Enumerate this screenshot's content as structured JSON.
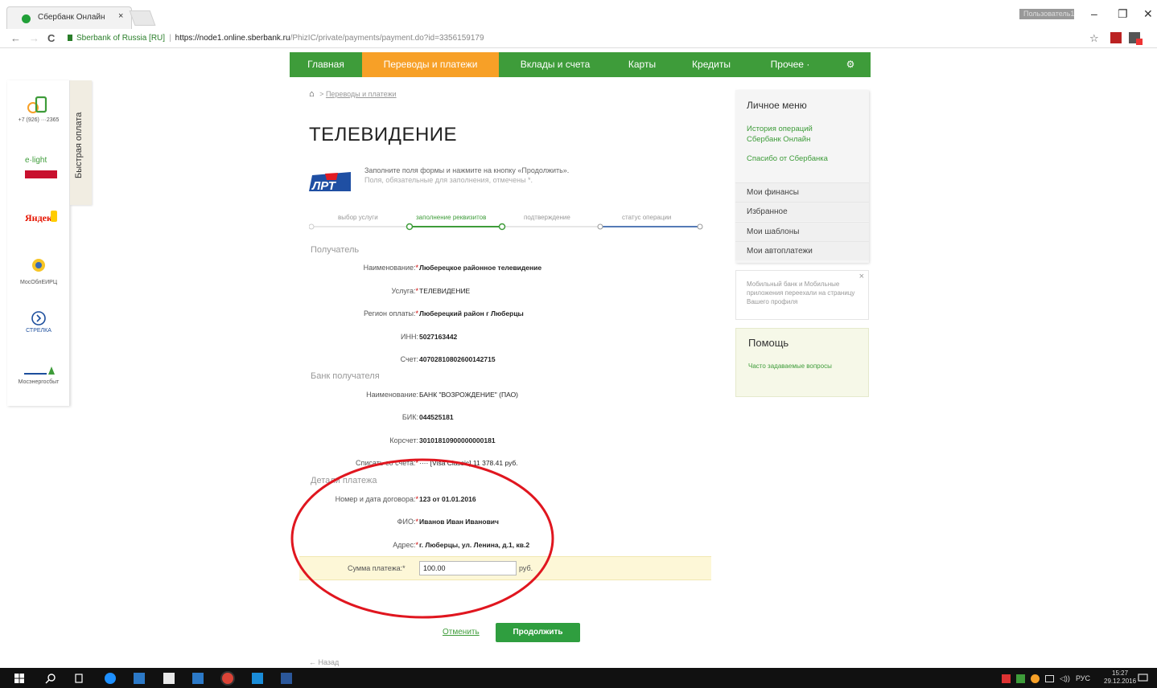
{
  "browser": {
    "tab_title": "Сбербанк Онлайн",
    "tab_close": "×",
    "user_chip": "Пользователь1",
    "url_site": "Sberbank of Russia [RU]",
    "url_sep": "|",
    "url_host": "https://node1.online.sberbank.ru",
    "url_path": "/PhizIC/private/payments/payment.do?id=3356159179",
    "btn_back": "←",
    "btn_forward": "→",
    "btn_reload": "C",
    "win_minimize": "–",
    "win_maximize": "❐",
    "win_close": "✕",
    "star": "☆"
  },
  "nav": {
    "items": [
      {
        "label": "Главная"
      },
      {
        "label": "Переводы и платежи"
      },
      {
        "label": "Вклады и счета"
      },
      {
        "label": "Карты"
      },
      {
        "label": "Кредиты"
      },
      {
        "label": "Прочее ·"
      }
    ],
    "settings_icon": "⚙"
  },
  "quickpay": {
    "tab_label": "Быстрая оплата",
    "items": [
      {
        "label": "+7 (926) ···2365",
        "icon": "phone-icon"
      },
      {
        "label": "",
        "icon": "enlight-logo"
      },
      {
        "label": "Яндекс",
        "icon": "yandex-logo"
      },
      {
        "label": "МосОблЕИРЦ",
        "icon": "mosobleirc-logo"
      },
      {
        "label": "СТРЕЛКА",
        "icon": "strelka-logo"
      },
      {
        "label": "Мосэнергосбыт",
        "icon": "mosenergo-logo"
      }
    ]
  },
  "breadcrumb": {
    "home_icon": "home-icon",
    "home_glyph": "⌂",
    "sep": ">",
    "crumb": "Переводы и платежи"
  },
  "page": {
    "title": "ТЕЛЕВИДЕНИЕ",
    "instruction": "Заполните поля формы и нажмите на кнопку «Продолжить».",
    "instruction_small": "Поля, обязательные для заполнения, отмечены *."
  },
  "steps": [
    {
      "label": "выбор услуги",
      "active": false
    },
    {
      "label": "заполнение реквизитов",
      "active": true
    },
    {
      "label": "подтверждение",
      "active": false
    },
    {
      "label": "статус операции",
      "active": false
    }
  ],
  "sections": {
    "recipient": "Получатель",
    "bank": "Банк получателя",
    "payment": "Детали платежа"
  },
  "recipient_fields": [
    {
      "label": "Наименование:",
      "required": true,
      "value": "Люберецкое районное телевидение"
    },
    {
      "label": "Услуга:",
      "required": true,
      "value": "ТЕЛЕВИДЕНИЕ"
    },
    {
      "label": "Регион оплаты:",
      "required": true,
      "value": "Люберецкий район г Люберцы"
    },
    {
      "label": "ИНН:",
      "required": false,
      "value": "5027163442"
    },
    {
      "label": "Счет:",
      "required": false,
      "value": "40702810802600142715"
    }
  ],
  "bank_fields": [
    {
      "label": "Наименование:",
      "required": false,
      "value": "БАНК \"ВОЗРОЖДЕНИЕ\" (ПАО)"
    },
    {
      "label": "БИК:",
      "required": false,
      "value": "044525181"
    },
    {
      "label": "Корсчет:",
      "required": false,
      "value": "30101810900000000181"
    }
  ],
  "debit": {
    "label": "Списать со счета:",
    "required": true,
    "value": "····   [Visa Classic] 11 378.41   руб."
  },
  "payment_fields": [
    {
      "label": "Номер и дата договора:",
      "required": true,
      "value": "123 от 01.01.2016"
    },
    {
      "label": "ФИО:",
      "required": true,
      "value": "Иванов Иван Иванович"
    },
    {
      "label": "Адрес:",
      "required": true,
      "value": "г. Люберцы, ул. Ленина, д.1, кв.2"
    }
  ],
  "amount": {
    "label": "Сумма платежа:",
    "value": "100.00",
    "currency": "руб."
  },
  "req_mark": "*",
  "actions": {
    "cancel": "Отменить",
    "continue": "Продолжить",
    "back": "← Назад"
  },
  "personal_menu": {
    "title": "Личное меню",
    "links": [
      "История операций Сбербанк Онлайн",
      "Спасибо от Сбербанка"
    ],
    "items": [
      "Мои финансы",
      "Избранное",
      "Мои шаблоны",
      "Мои автоплатежи"
    ]
  },
  "notice": {
    "text": "Мобильный банк и Мобильные приложения переехали на страницу Вашего профиля",
    "close": "×"
  },
  "help": {
    "title": "Помощь",
    "link": "Часто задаваемые вопросы"
  },
  "taskbar": {
    "lang": "РУС",
    "time": "15:27",
    "date": "29.12.2016"
  },
  "colors": {
    "nav_green": "#3e9c3a",
    "nav_active": "#f7a027",
    "button_green": "#2f9e3f",
    "annotation_red": "#e0161f",
    "amount_row_bg": "#fdf7d7"
  }
}
